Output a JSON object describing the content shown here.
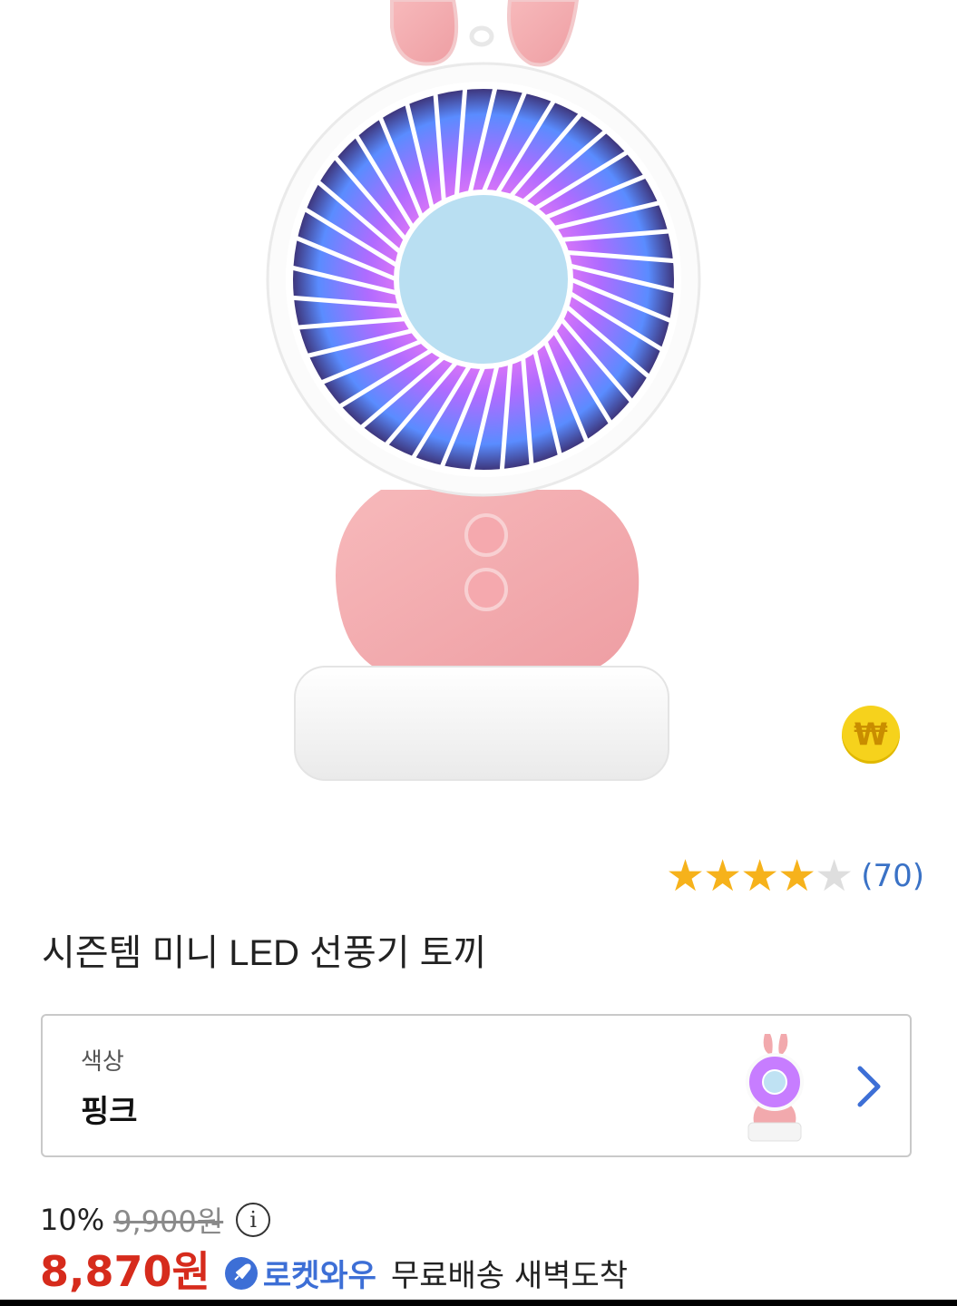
{
  "product": {
    "title": "시즌템 미니 LED 선풍기 토끼",
    "image_icon": "rabbit-led-fan-image",
    "cashback_symbol": "₩"
  },
  "rating": {
    "stars": 4,
    "max_stars": 5,
    "count": "(70)"
  },
  "option": {
    "label": "색상",
    "value": "핑크"
  },
  "price": {
    "discount": "10%",
    "original": "9,900원",
    "info_symbol": "i",
    "sale": "8,870원"
  },
  "delivery": {
    "badge": "로켓와우",
    "text": "무료배송 새벽도착"
  },
  "colors": {
    "accent_red": "#d62b1c",
    "rocket_blue": "#3d6fd6",
    "star_gold": "#f6b21b",
    "coin_yellow": "#f6d21c"
  }
}
